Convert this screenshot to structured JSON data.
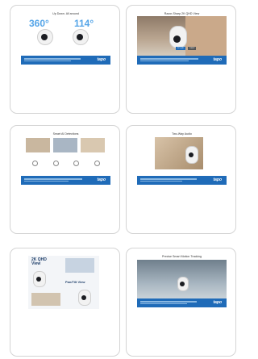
{
  "cards": [
    {
      "title": "Up Down. All around",
      "n1": "360°",
      "n2": "114°",
      "logo": "tapo"
    },
    {
      "title": "Razor-Sharp 2K QHD View",
      "badge1": "2K QHD",
      "badge2": "1080P",
      "logo": "tapo"
    },
    {
      "title": "Smart AI Detections",
      "logo": "tapo"
    },
    {
      "title": "Two-Way Audio",
      "logo": "tapo"
    },
    {
      "title": "",
      "h1": "2K QHD View",
      "h2": "Pan/Tilt View"
    },
    {
      "title": "Precise Smart Motion Tracking",
      "logo": "tapo"
    }
  ],
  "colors": {
    "accent": "#1f6bb8",
    "light_accent": "#55a5e8",
    "card_border": "#d4d4d4"
  }
}
